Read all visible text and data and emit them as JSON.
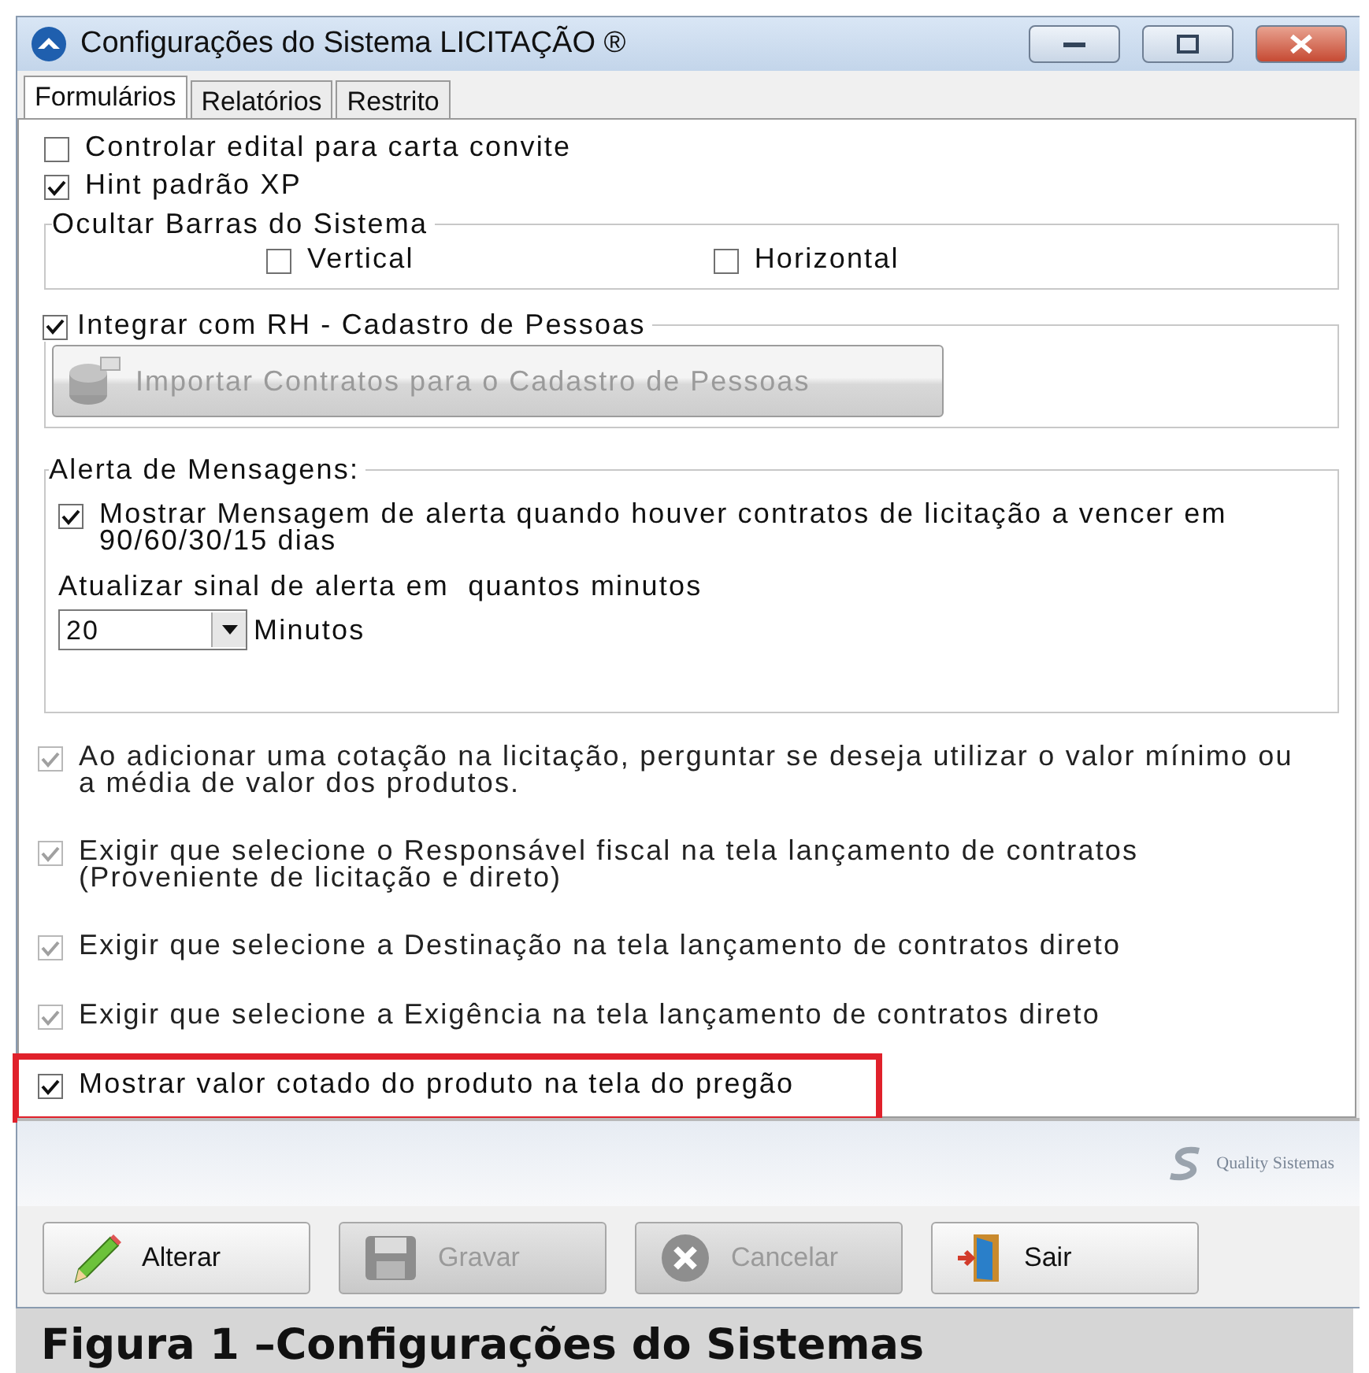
{
  "window": {
    "title": "Configurações do Sistema LICITAÇÃO ®"
  },
  "tabs": [
    {
      "label": "Formulários",
      "selected": true
    },
    {
      "label": "Relatórios",
      "selected": false
    },
    {
      "label": "Restrito",
      "selected": false
    }
  ],
  "options_top": [
    {
      "label": "Controlar edital para carta convite",
      "checked": false
    },
    {
      "label": "Hint padrão XP",
      "checked": true
    }
  ],
  "hide_bars": {
    "title": "Ocultar Barras do Sistema",
    "options": [
      {
        "label": "Vertical",
        "checked": false
      },
      {
        "label": "Horizontal",
        "checked": false
      }
    ]
  },
  "rh": {
    "label": "Integrar com RH - Cadastro de Pessoas",
    "checked": true,
    "import_button": {
      "label": "Importar Contratos para o Cadastro de Pessoas",
      "disabled": true
    }
  },
  "alerts": {
    "title": "Alerta de Mensagens:",
    "option": {
      "label": "Mostrar Mensagem de alerta quando houver contratos de licitação a vencer em 90/60/30/15 dias",
      "checked": true
    },
    "refresh_label": "Atualizar sinal de alerta em  quantos minutos",
    "interval": "20",
    "unit": "Minutos"
  },
  "options_bottom": [
    {
      "label": "Ao adicionar uma cotação na licitação, perguntar se deseja utilizar o valor mínimo ou a média de valor dos produtos.",
      "checked": true,
      "disabled": true,
      "highlighted": false
    },
    {
      "label": "Exigir que selecione o Responsável fiscal na tela lançamento de contratos (Proveniente de licitação e direto)",
      "checked": true,
      "disabled": true,
      "highlighted": false
    },
    {
      "label": "Exigir que selecione a Destinação na tela lançamento de contratos direto",
      "checked": true,
      "disabled": true,
      "highlighted": false
    },
    {
      "label": "Exigir que selecione a Exigência na tela lançamento de contratos direto",
      "checked": true,
      "disabled": true,
      "highlighted": false
    },
    {
      "label": "Mostrar valor cotado do produto na tela do pregão",
      "checked": true,
      "disabled": false,
      "highlighted": true
    }
  ],
  "logo": {
    "text": "Quality Sistemas"
  },
  "buttons": [
    {
      "kind": "edit",
      "label": "Alterar",
      "disabled": false
    },
    {
      "kind": "save",
      "label": "Gravar",
      "disabled": true
    },
    {
      "kind": "cancel",
      "label": "Cancelar",
      "disabled": true
    },
    {
      "kind": "exit",
      "label": "Sair",
      "disabled": false
    }
  ],
  "caption": "Figura 1 –Configurações do Sistemas"
}
